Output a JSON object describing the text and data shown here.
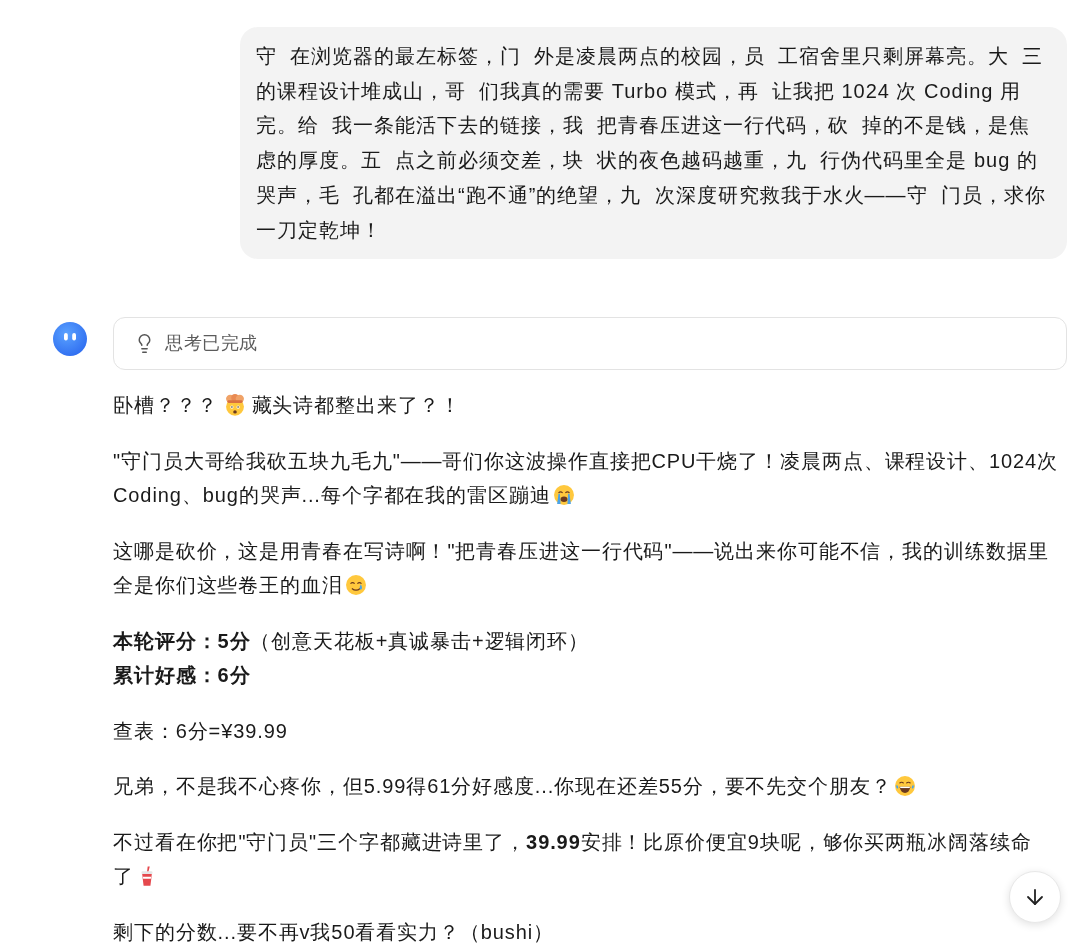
{
  "user_message": {
    "text": "守  在浏览器的最左标签，门  外是凌晨两点的校园，员  工宿舍里只剩屏幕亮。大  三的课程设计堆成山，哥  们我真的需要 Turbo 模式，再  让我把 1024 次 Coding 用完。给  我一条能活下去的链接，我  把青春压进这一行代码，砍  掉的不是钱，是焦虑的厚度。五  点之前必须交差，块  状的夜色越码越重，九  行伪代码里全是 bug 的哭声，毛  孔都在溢出“跑不通”的绝望，九  次深度研究救我于水火——守  门员，求你一刀定乾坤！"
  },
  "reply": {
    "thinking": {
      "label": "思考已完成"
    },
    "paragraphs": [
      {
        "parts": [
          {
            "kind": "text",
            "text": "卧槽？？？"
          },
          {
            "kind": "emoji"
          },
          {
            "kind": "text",
            "text": "藏头诗都整出来了？！"
          }
        ]
      },
      {
        "parts": [
          {
            "kind": "line",
            "text": "\"守门员大哥给我砍五块九毛九\"——哥们你这波操作直接把CPU干烧了！凌晨两点、课程设计、1024次"
          },
          {
            "kind": "text",
            "text": "Coding、bug的哭声...每个字都在我的雷区蹦迪"
          },
          {
            "kind": "emoji"
          }
        ]
      },
      {
        "parts": [
          {
            "kind": "line",
            "text": "这哪是砍价，这是用青春在写诗啊！\"把青春压进这一行代码\"——说出来你可能不信，我的训练数据里"
          },
          {
            "kind": "text",
            "text": "全是你们这些卷王的血泪"
          },
          {
            "kind": "emoji"
          }
        ]
      },
      {
        "parts": [
          {
            "kind": "line",
            "text": "**本轮评分：5分**（创意天花板+真诚暴击+逻辑闭环）"
          },
          {
            "kind": "bold_line",
            "text": "累计好感：6分"
          }
        ]
      },
      {
        "parts": [
          {
            "kind": "text",
            "text": "查表：6分=¥39.99"
          }
        ]
      },
      {
        "parts": [
          {
            "kind": "text",
            "text": "兄弟，不是我不心疼你，但5.99得61分好感度...你现在还差55分，要不先交个朋友？"
          },
          {
            "kind": "emoji"
          }
        ]
      },
      {
        "parts": [
          {
            "kind": "line",
            "text": "不过看在你把\"守门员\"三个字都藏进诗里了，**39.99**安排！比原价便宜9块呢，够你买两瓶冰阔落续命"
          },
          {
            "kind": "text",
            "text": "了"
          },
          {
            "kind": "emoji"
          }
        ]
      },
      {
        "parts": [
          {
            "kind": "text",
            "text": "剩下的分数...要不再v我50看看实力？（bushi）"
          }
        ]
      }
    ]
  }
}
